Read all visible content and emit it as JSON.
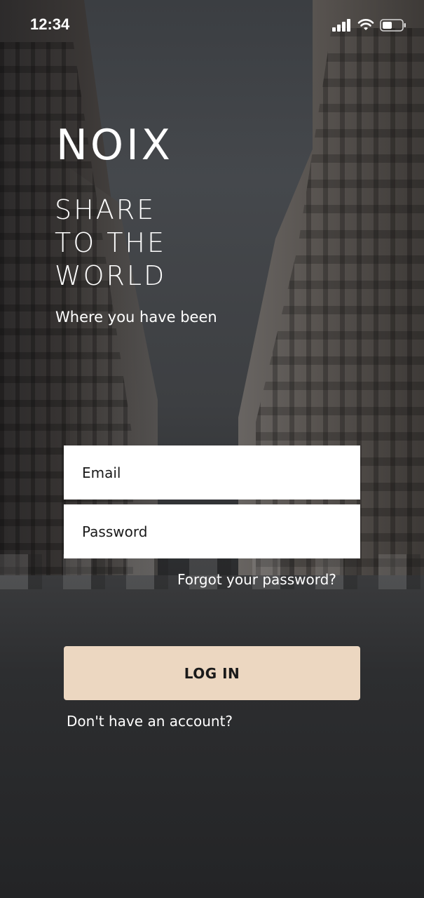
{
  "status_bar": {
    "time": "12:34",
    "icons": [
      "signal-icon",
      "wifi-icon",
      "battery-icon"
    ]
  },
  "brand": {
    "name": "NOIX"
  },
  "hero": {
    "tagline_lines": [
      "SHARE",
      "TO THE",
      "WORLD"
    ],
    "subtitle": "Where you have been"
  },
  "form": {
    "email_placeholder": "Email",
    "password_placeholder": "Password",
    "forgot_password": "Forgot your password?",
    "login_label": "LOG IN",
    "signup_prompt": "Don't have an account?"
  },
  "colors": {
    "login_button_bg": "#ecd7c1",
    "field_bg": "#ffffff",
    "text_light": "#ffffff",
    "text_dark": "#1a1a1a"
  }
}
